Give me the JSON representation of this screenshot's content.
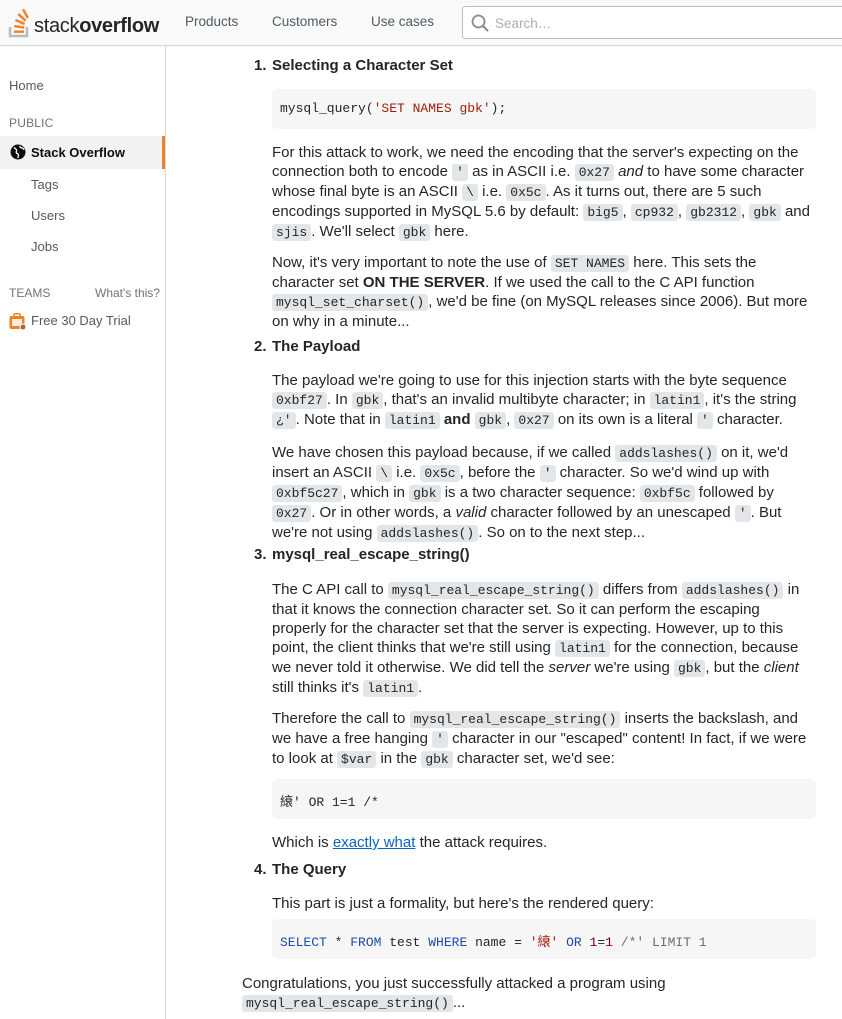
{
  "header": {
    "logo_light": "stack",
    "logo_bold": "overflow",
    "nav": [
      "Products",
      "Customers",
      "Use cases"
    ],
    "search_placeholder": "Search…"
  },
  "sidebar": {
    "home": "Home",
    "public_label": "PUBLIC",
    "active_item": "Stack Overflow",
    "items": [
      "Tags",
      "Users",
      "Jobs"
    ],
    "teams_label": "TEAMS",
    "whats_this": "What's this?",
    "trial": "Free 30 Day Trial"
  },
  "article": {
    "step1": {
      "num": "1.",
      "title": "Selecting a Character Set",
      "code": {
        "fn": "mysql_query(",
        "str": "'SET NAMES gbk'",
        "end": ");"
      },
      "p1": {
        "a": "For this attack to work, we need the encoding that the server's expecting on the connection both to encode",
        "c1": "'",
        "b": "as in ASCII i.e.",
        "c2": "0x27",
        "and": "and",
        "c": "to have some character whose final byte is an ASCII",
        "c3": "\\",
        "d": "i.e.",
        "c4": "0x5c",
        "e": ". As it turns out, there are 5 such encodings supported in MySQL 5.6 by default:",
        "enc": [
          "big5",
          "cp932",
          "gb2312",
          "gbk",
          "sjis"
        ],
        "and2": "and",
        "f": ". We'll select",
        "c5": "gbk",
        "g": "here."
      },
      "p2": {
        "a": "Now, it's very important to note the use of",
        "c1": "SET NAMES",
        "b": "here. This sets the character set",
        "strong": "ON THE SERVER",
        "c": ". If we used the call to the C API function",
        "c2": "mysql_set_charset()",
        "d": ", we'd be fine (on MySQL releases since 2006). But more on why in a minute..."
      }
    },
    "step2": {
      "num": "2.",
      "title": "The Payload",
      "p1": {
        "a": "The payload we're going to use for this injection starts with the byte sequence",
        "c1": "0xbf27",
        "b": ". In",
        "c2": "gbk",
        "c": ", that's an invalid multibyte character; in",
        "c3": "latin1",
        "d": ", it's the string",
        "c4": "¿'",
        "e": ". Note that in",
        "c5": "latin1",
        "and": "and",
        "c6": "gbk",
        "f": ",",
        "c7": "0x27",
        "g": "on its own is a literal",
        "c8": "'",
        "h": "character."
      },
      "p2": {
        "a": "We have chosen this payload because, if we called",
        "c1": "addslashes()",
        "b": "on it, we'd insert an ASCII",
        "c2": "\\",
        "c": "i.e.",
        "c3": "0x5c",
        "d": ", before the",
        "c4": "'",
        "e": "character. So we'd wind up with",
        "c5": "0xbf5c27",
        "f": ", which in",
        "c6": "gbk",
        "g": "is a two character sequence:",
        "c7": "0xbf5c",
        "h": "followed by",
        "c8": "0x27",
        "i": ". Or in other words, a",
        "em": "valid",
        "j": "character followed by an unescaped",
        "c9": "'",
        "k": ". But we're not using",
        "c10": "addslashes()",
        "l": ". So on to the next step..."
      }
    },
    "step3": {
      "num": "3.",
      "title": "mysql_real_escape_string()",
      "p1": {
        "a": "The C API call to",
        "c1": "mysql_real_escape_string()",
        "b": "differs from",
        "c2": "addslashes()",
        "c": "in that it knows the connection character set. So it can perform the escaping properly for the character set that the server is expecting. However, up to this point, the client thinks that we're still using",
        "c3": "latin1",
        "d": "for the connection, because we never told it otherwise. We did tell the",
        "em1": "server",
        "e": "we're using",
        "c4": "gbk",
        "f": ", but the",
        "em2": "client",
        "g": "still thinks it's",
        "c5": "latin1",
        "h": "."
      },
      "p2": {
        "a": "Therefore the call to",
        "c1": "mysql_real_escape_string()",
        "b": "inserts the backslash, and we have a free hanging",
        "c2": "'",
        "c": "character in our \"escaped\" content! In fact, if we were to look at",
        "c3": "$var",
        "d": "in the",
        "c4": "gbk",
        "e": "character set, we'd see:"
      },
      "code": "縗' OR 1=1 /*",
      "p3": {
        "a": "Which is",
        "link": "exactly what",
        "b": "the attack requires."
      }
    },
    "step4": {
      "num": "4.",
      "title": "The Query",
      "p1": "This part is just a formality, but here's the rendered query:",
      "code": {
        "kw1": "SELECT",
        "t1": " * ",
        "kw2": "FROM",
        "t2": " test ",
        "kw3": "WHERE",
        "t3": " name = ",
        "str": "'縗'",
        "t4": " ",
        "kw4": "OR",
        "t5": " ",
        "n1": "1",
        "t6": "=",
        "n2": "1",
        "t7": " ",
        "cmt": "/*' LIMIT 1"
      }
    },
    "closing": {
      "a": "Congratulations, you just successfully attacked a program using",
      "c1": "mysql_real_escape_string()",
      "b": "..."
    }
  }
}
